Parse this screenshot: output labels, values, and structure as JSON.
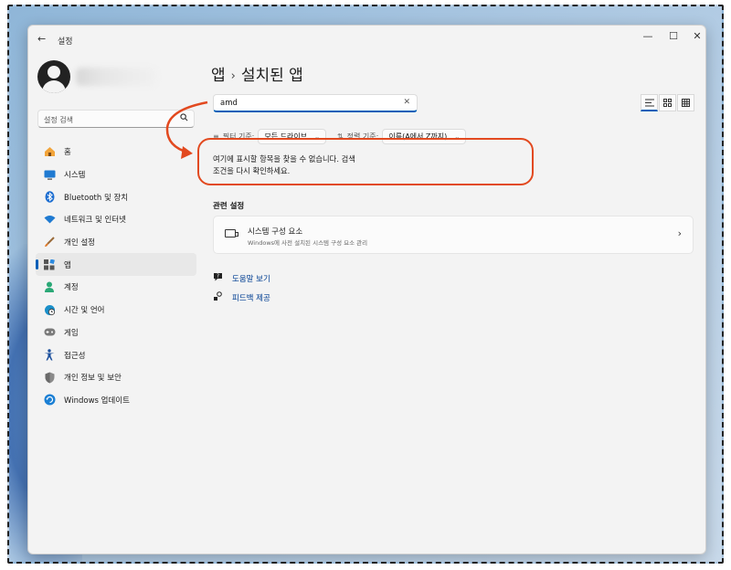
{
  "window": {
    "app_title": "설정",
    "back_label": "←",
    "minimize_label": "—",
    "maximize_label": "☐",
    "close_label": "✕"
  },
  "sidebar": {
    "search_placeholder": "설정 검색",
    "search_icon": "search-icon",
    "items": [
      {
        "label": "홈",
        "icon": "home-icon"
      },
      {
        "label": "시스템",
        "icon": "monitor-icon"
      },
      {
        "label": "Bluetooth 및 장치",
        "icon": "bluetooth-icon"
      },
      {
        "label": "네트워크 및 인터넷",
        "icon": "wifi-icon"
      },
      {
        "label": "개인 설정",
        "icon": "brush-icon"
      },
      {
        "label": "앱",
        "icon": "apps-icon",
        "selected": true
      },
      {
        "label": "계정",
        "icon": "person-icon"
      },
      {
        "label": "시간 및 언어",
        "icon": "globe-clock-icon"
      },
      {
        "label": "게임",
        "icon": "gamepad-icon"
      },
      {
        "label": "접근성",
        "icon": "accessibility-icon"
      },
      {
        "label": "개인 정보 및 보안",
        "icon": "shield-icon"
      },
      {
        "label": "Windows 업데이트",
        "icon": "update-icon"
      }
    ]
  },
  "main": {
    "breadcrumb_parent": "앱",
    "breadcrumb_sep": "›",
    "breadcrumb_current": "설치된 앱",
    "search_value": "amd",
    "filter_label": "필터 기준:",
    "filter_value": "모든 드라이브",
    "sort_label": "정렬 기준:",
    "sort_value": "이름(A에서 Z까지)",
    "no_result_line1": "여기에 표시할 항목을 찾을 수 없습니다. 검색",
    "no_result_line2": "조건을 다시 확인하세요.",
    "related_title": "관련 설정",
    "related_card_title": "시스템 구성 요소",
    "related_card_subtitle": "Windows에 사전 설치된 시스템 구성 요소 관리",
    "help_link": "도움말 보기",
    "feedback_link": "피드백 제공"
  },
  "colors": {
    "accent": "#005fb8",
    "annotation": "#e2491f"
  }
}
